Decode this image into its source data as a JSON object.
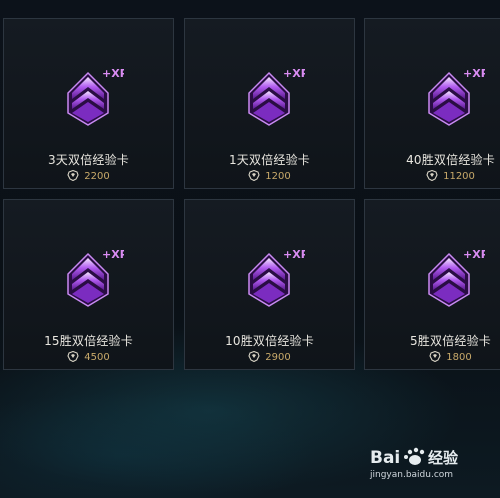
{
  "cards": [
    {
      "title": "3天双倍经验卡",
      "price": "2200"
    },
    {
      "title": "1天双倍经验卡",
      "price": "1200"
    },
    {
      "title": "40胜双倍经验卡",
      "price": "11200"
    },
    {
      "title": "15胜双倍经验卡",
      "price": "4500"
    },
    {
      "title": "10胜双倍经验卡",
      "price": "2900"
    },
    {
      "title": "5胜双倍经验卡",
      "price": "1800"
    }
  ],
  "badge_text": "+XP",
  "icons": {
    "emblem": "xp-boost-chevron-icon",
    "currency": "riot-points-icon"
  },
  "colors": {
    "card_bg": "#12171d",
    "card_border": "#2d3640",
    "title": "#e8e6df",
    "price": "#c8a96a",
    "emblem_purple": "#9b3fe0",
    "xp_badge": "#d98cf2"
  },
  "watermark": {
    "logo_text": "Bai 经验",
    "url": "jingyan.baidu.com"
  }
}
